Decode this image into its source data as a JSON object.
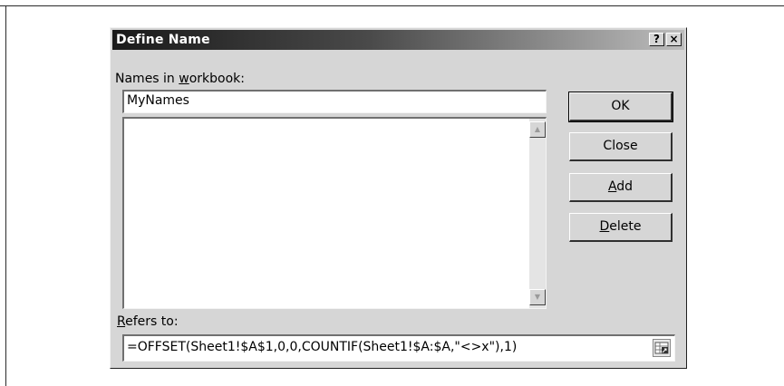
{
  "dialog": {
    "title": "Define Name",
    "help_button": "?",
    "close_button": "×"
  },
  "names_label": {
    "before": "Names in ",
    "mnemonic": "w",
    "after": "orkbook:"
  },
  "name_input": {
    "value": "MyNames"
  },
  "names_list": {
    "items": []
  },
  "buttons": {
    "ok": {
      "label": "OK"
    },
    "close": {
      "label": "Close"
    },
    "add": {
      "mnemonic": "A",
      "after": "dd"
    },
    "delete": {
      "mnemonic": "D",
      "after": "elete"
    }
  },
  "refers_label": {
    "mnemonic": "R",
    "after": "efers to:"
  },
  "refers_input": {
    "value": "=OFFSET(Sheet1!$A$1,0,0,COUNTIF(Sheet1!$A:$A,\"<>x\"),1)"
  },
  "icons": {
    "scroll_up": "triangle-up",
    "scroll_down": "triangle-down",
    "collapse": "collapse-dialog"
  }
}
